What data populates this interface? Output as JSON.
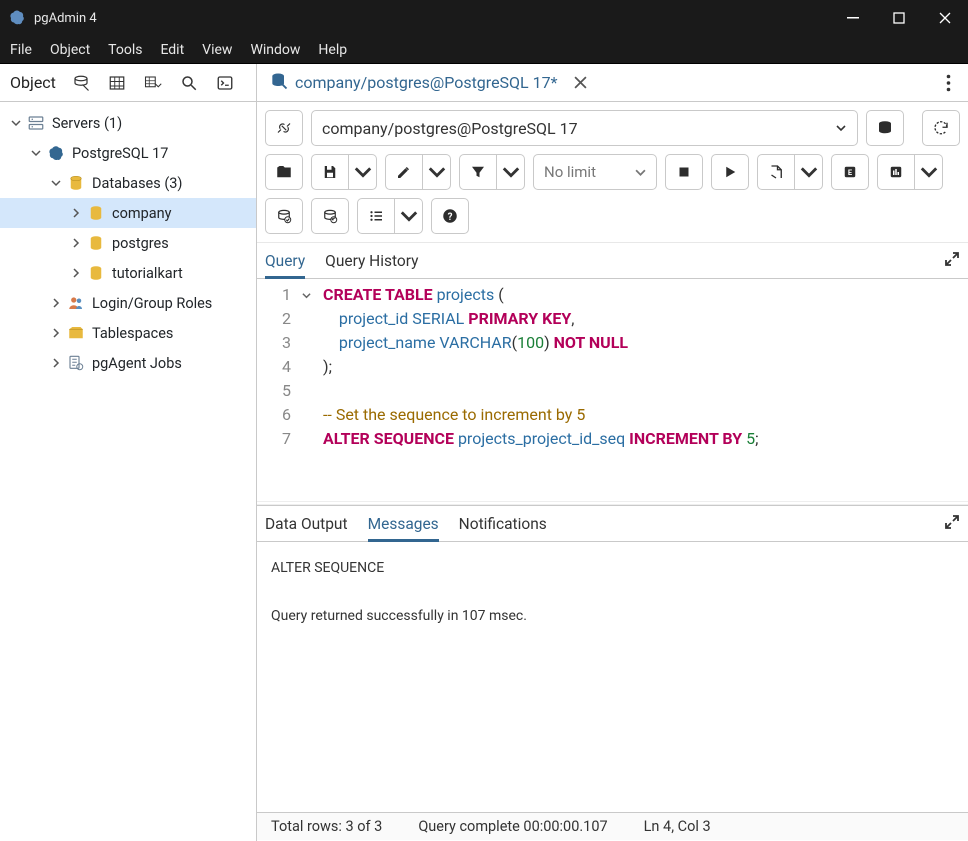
{
  "window": {
    "title": "pgAdmin 4"
  },
  "menubar": [
    "File",
    "Object",
    "Tools",
    "Edit",
    "View",
    "Window",
    "Help"
  ],
  "sidebar": {
    "heading": "Object",
    "tree": {
      "servers": {
        "label": "Servers (1)"
      },
      "pg17": {
        "label": "PostgreSQL 17"
      },
      "databases": {
        "label": "Databases (3)"
      },
      "db_company": {
        "label": "company"
      },
      "db_postgres": {
        "label": "postgres"
      },
      "db_tutorialkart": {
        "label": "tutorialkart"
      },
      "login_roles": {
        "label": "Login/Group Roles"
      },
      "tablespaces": {
        "label": "Tablespaces"
      },
      "pgagent": {
        "label": "pgAgent Jobs"
      }
    }
  },
  "tab": {
    "title": "company/postgres@PostgreSQL 17*"
  },
  "connection": {
    "label": "company/postgres@PostgreSQL 17"
  },
  "limit": {
    "label": "No limit"
  },
  "query_tabs": {
    "query": "Query",
    "history": "Query History"
  },
  "sql": {
    "lines": [
      "1",
      "2",
      "3",
      "4",
      "5",
      "6",
      "7"
    ],
    "l1_create": "CREATE TABLE",
    "l1_ident": " projects",
    "l1_paren": " (",
    "l2_indent": "    ",
    "l2_col": "project_id",
    "l2_type": " SERIAL",
    "l2_pk": " PRIMARY KEY",
    "l2_comma": ",",
    "l3_indent": "    ",
    "l3_col": "project_name",
    "l3_type": " VARCHAR",
    "l3_paren_open": "(",
    "l3_num": "100",
    "l3_paren_close": ")",
    "l3_nn": " NOT NULL",
    "l4_close": ");",
    "l5": "",
    "l6_comment": "-- Set the sequence to increment by 5",
    "l7_alter": "ALTER SEQUENCE",
    "l7_ident": " projects_project_id_seq",
    "l7_inc": " INCREMENT BY",
    "l7_num": " 5",
    "l7_semi": ";"
  },
  "output_tabs": {
    "data": "Data Output",
    "messages": "Messages",
    "notif": "Notifications"
  },
  "messages": {
    "line1": "ALTER SEQUENCE",
    "line2": "Query returned successfully in 107 msec."
  },
  "status": {
    "rows": "Total rows: 3 of 3",
    "time": "Query complete 00:00:00.107",
    "pos": "Ln 4, Col 3"
  }
}
